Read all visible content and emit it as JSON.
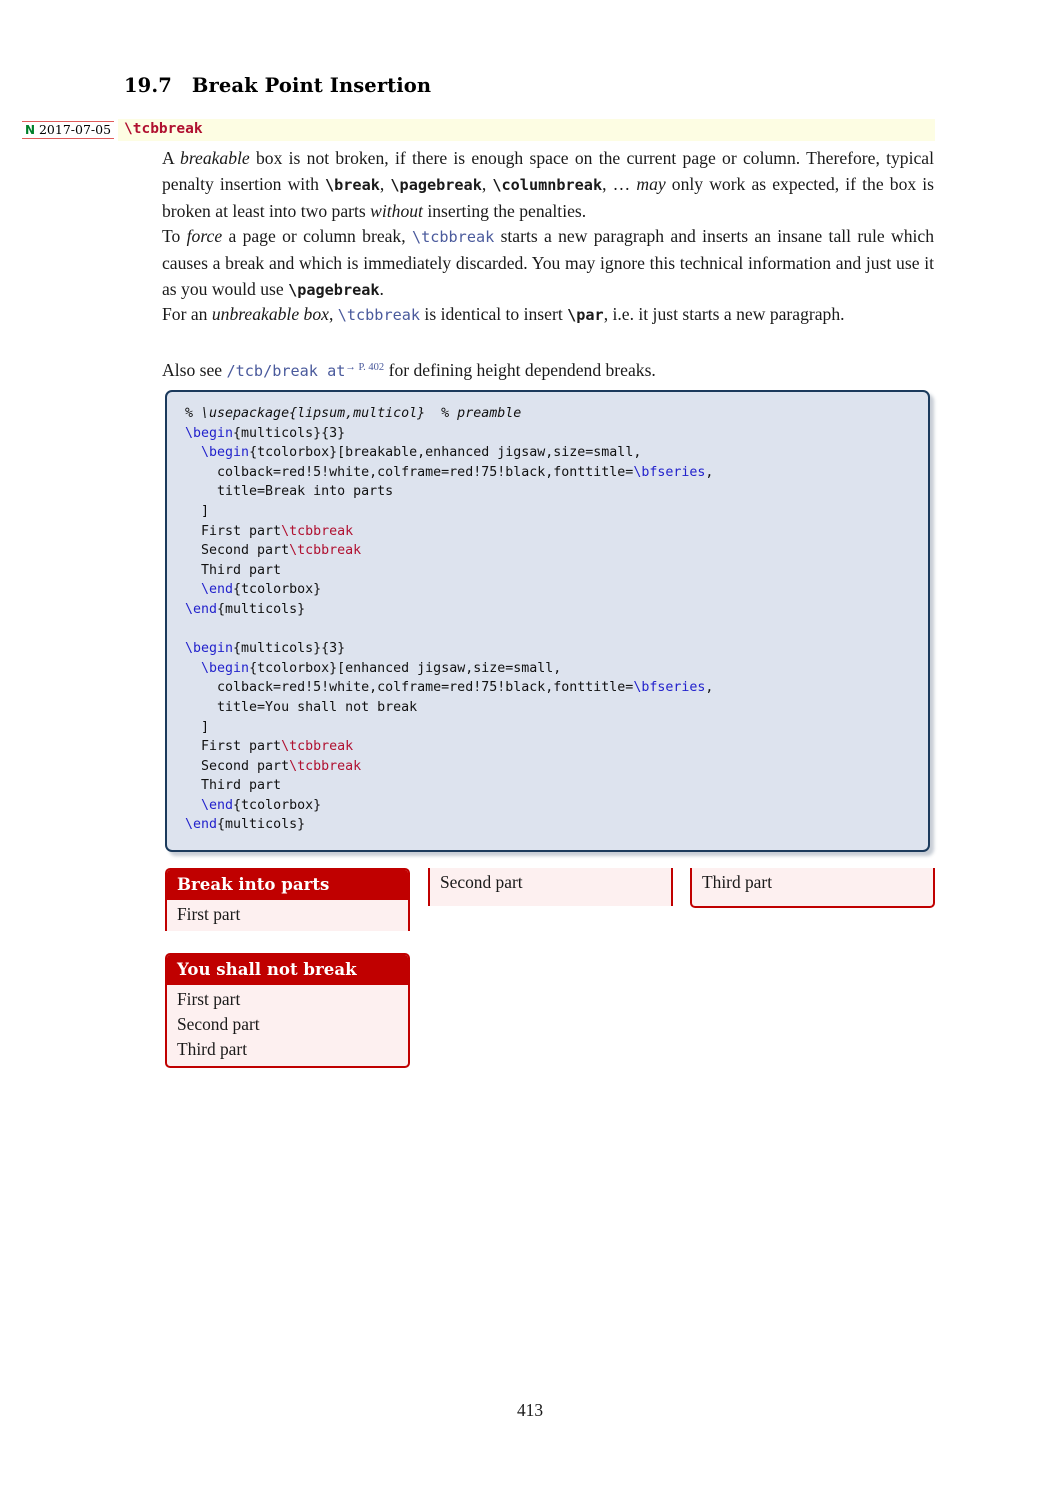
{
  "page": {
    "number": "413",
    "accent_code_border": "#1b3a5c",
    "accent_code_background": "#dde3ee",
    "accent_box_red": "#c00000",
    "accent_box_background": "#fdf0f0",
    "accent_command": "#b01030",
    "accent_keyword": "#2222cc",
    "accent_link": "#4a5a9c",
    "accent_highlight_band": "#fdfde3",
    "accent_marker_rule": "#e05a5a",
    "accent_new_flag": "#00802b"
  },
  "section": {
    "number": "19.7",
    "title": "Break Point Insertion"
  },
  "margin_marker": {
    "flag": "N",
    "date": "2017-07-05"
  },
  "command": {
    "name": "\\tcbbreak"
  },
  "paragraphs": {
    "p1_a": "A ",
    "p1_b": "breakable",
    "p1_c": " box is not broken, if there is enough space on the current page or column. Therefore, typical penalty insertion with ",
    "p1_d": "\\break",
    "p1_e": ", ",
    "p1_f": "\\pagebreak",
    "p1_g": ", ",
    "p1_h": "\\columnbreak",
    "p1_i": ", … ",
    "p1_j": "may",
    "p1_k": " only work as expected, if the box is broken at least into two parts ",
    "p1_l": "without",
    "p1_m": " inserting the penalties.",
    "p2_a": "To ",
    "p2_b": "force",
    "p2_c": " a page or column break, ",
    "p2_d": "\\tcbbreak",
    "p2_e": " starts a new paragraph and inserts an insane tall rule which causes a break and which is immediately discarded. You may ignore this technical information and just use it as you would use ",
    "p2_f": "\\pagebreak",
    "p2_g": ".",
    "p3_a": "For an ",
    "p3_b": "unbreakable box",
    "p3_c": ", ",
    "p3_d": "\\tcbbreak",
    "p3_e": " is identical to insert ",
    "p3_f": "\\par",
    "p3_g": ", i.e. it just starts a new paragraph.",
    "p4_a": "Also see ",
    "p4_b": "/tcb/break at",
    "p4_c": "→ P. 402",
    "p4_d": " for defining height dependend breaks."
  },
  "code_listing": {
    "lines": [
      {
        "segments": [
          {
            "text": "% \\usepackage{lipsum,multicol}  % preamble",
            "style": "cm"
          }
        ]
      },
      {
        "segments": [
          {
            "text": "\\begin",
            "style": "kw"
          },
          {
            "text": "{multicols}{3}",
            "style": ""
          }
        ]
      },
      {
        "segments": [
          {
            "text": "  ",
            "style": ""
          },
          {
            "text": "\\begin",
            "style": "kw"
          },
          {
            "text": "{tcolorbox}[breakable,enhanced jigsaw,size=small,",
            "style": ""
          }
        ]
      },
      {
        "segments": [
          {
            "text": "    colback=red!5!white,colframe=red!75!black,fonttitle=",
            "style": ""
          },
          {
            "text": "\\bfseries",
            "style": "kw"
          },
          {
            "text": ",",
            "style": ""
          }
        ]
      },
      {
        "segments": [
          {
            "text": "    title=Break into parts",
            "style": ""
          }
        ]
      },
      {
        "segments": [
          {
            "text": "  ]",
            "style": ""
          }
        ]
      },
      {
        "segments": [
          {
            "text": "  First part",
            "style": ""
          },
          {
            "text": "\\tcbbreak",
            "style": "cmd"
          }
        ]
      },
      {
        "segments": [
          {
            "text": "  Second part",
            "style": ""
          },
          {
            "text": "\\tcbbreak",
            "style": "cmd"
          }
        ]
      },
      {
        "segments": [
          {
            "text": "  Third part",
            "style": ""
          }
        ]
      },
      {
        "segments": [
          {
            "text": "  ",
            "style": ""
          },
          {
            "text": "\\end",
            "style": "kw"
          },
          {
            "text": "{tcolorbox}",
            "style": ""
          }
        ]
      },
      {
        "segments": [
          {
            "text": "\\end",
            "style": "kw"
          },
          {
            "text": "{multicols}",
            "style": ""
          }
        ]
      },
      {
        "segments": [
          {
            "text": "",
            "style": ""
          }
        ]
      },
      {
        "segments": [
          {
            "text": "\\begin",
            "style": "kw"
          },
          {
            "text": "{multicols}{3}",
            "style": ""
          }
        ]
      },
      {
        "segments": [
          {
            "text": "  ",
            "style": ""
          },
          {
            "text": "\\begin",
            "style": "kw"
          },
          {
            "text": "{tcolorbox}[enhanced jigsaw,size=small,",
            "style": ""
          }
        ]
      },
      {
        "segments": [
          {
            "text": "    colback=red!5!white,colframe=red!75!black,fonttitle=",
            "style": ""
          },
          {
            "text": "\\bfseries",
            "style": "kw"
          },
          {
            "text": ",",
            "style": ""
          }
        ]
      },
      {
        "segments": [
          {
            "text": "    title=You shall not break",
            "style": ""
          }
        ]
      },
      {
        "segments": [
          {
            "text": "  ]",
            "style": ""
          }
        ]
      },
      {
        "segments": [
          {
            "text": "  First part",
            "style": ""
          },
          {
            "text": "\\tcbbreak",
            "style": "cmd"
          }
        ]
      },
      {
        "segments": [
          {
            "text": "  Second part",
            "style": ""
          },
          {
            "text": "\\tcbbreak",
            "style": "cmd"
          }
        ]
      },
      {
        "segments": [
          {
            "text": "  Third part",
            "style": ""
          }
        ]
      },
      {
        "segments": [
          {
            "text": "  ",
            "style": ""
          },
          {
            "text": "\\end",
            "style": "kw"
          },
          {
            "text": "{tcolorbox}",
            "style": ""
          }
        ]
      },
      {
        "segments": [
          {
            "text": "\\end",
            "style": "kw"
          },
          {
            "text": "{multicols}",
            "style": ""
          }
        ]
      }
    ]
  },
  "result_boxes": {
    "breakable": {
      "part1_title": "Break into parts",
      "part1_body": "First part",
      "part2_body": "Second part",
      "part3_body": "Third part"
    },
    "unbreakable": {
      "title": "You shall not break",
      "body_lines": [
        "First part",
        "Second part",
        "Third part"
      ]
    }
  }
}
